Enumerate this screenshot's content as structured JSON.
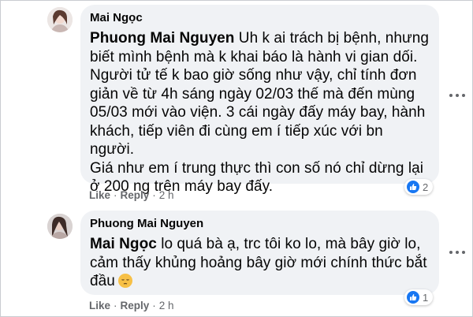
{
  "comments": [
    {
      "author": "Mai Ngọc",
      "mention": "Phuong Mai Nguyen",
      "text": " Uh k ai trách bị bệnh, nhưng\nbiết mình bệnh mà k khai báo là hành vi gian dối.\nNgười tử tế k bao giờ sống như vậy, chỉ tính đơn\ngiản về từ 4h sáng ngày 02/03 thế mà đến mùng\n05/03 mới vào viện. 3 cái ngày đấy máy bay, hành\nkhách, tiếp viên đi cùng em í tiếp xúc với bn người.\nGiá như em í trung thực thì con số nó chỉ dừng lại\nở 200 ng trên máy bay đấy.",
      "like_label": "Like",
      "reply_label": "Reply",
      "time": "2 h",
      "reaction_count": "2"
    },
    {
      "author": "Phuong Mai Nguyen",
      "mention": "Mai Ngọc",
      "text": " lo quá bà ạ, trc tôi ko lo, mà bây giờ lo,\ncảm thấy khủng hoảng bây giờ mới chính thức bắt\nđầu",
      "like_label": "Like",
      "reply_label": "Reply",
      "time": "2 h",
      "reaction_count": "1"
    }
  ],
  "icons": {
    "reaction": "like-icon",
    "menu": "more-options-icon",
    "emoji": "pensive-face-emoji"
  },
  "colors": {
    "bubble": "#f0f2f5",
    "secondary_text": "#65676b",
    "like_blue": "#1877f2"
  }
}
